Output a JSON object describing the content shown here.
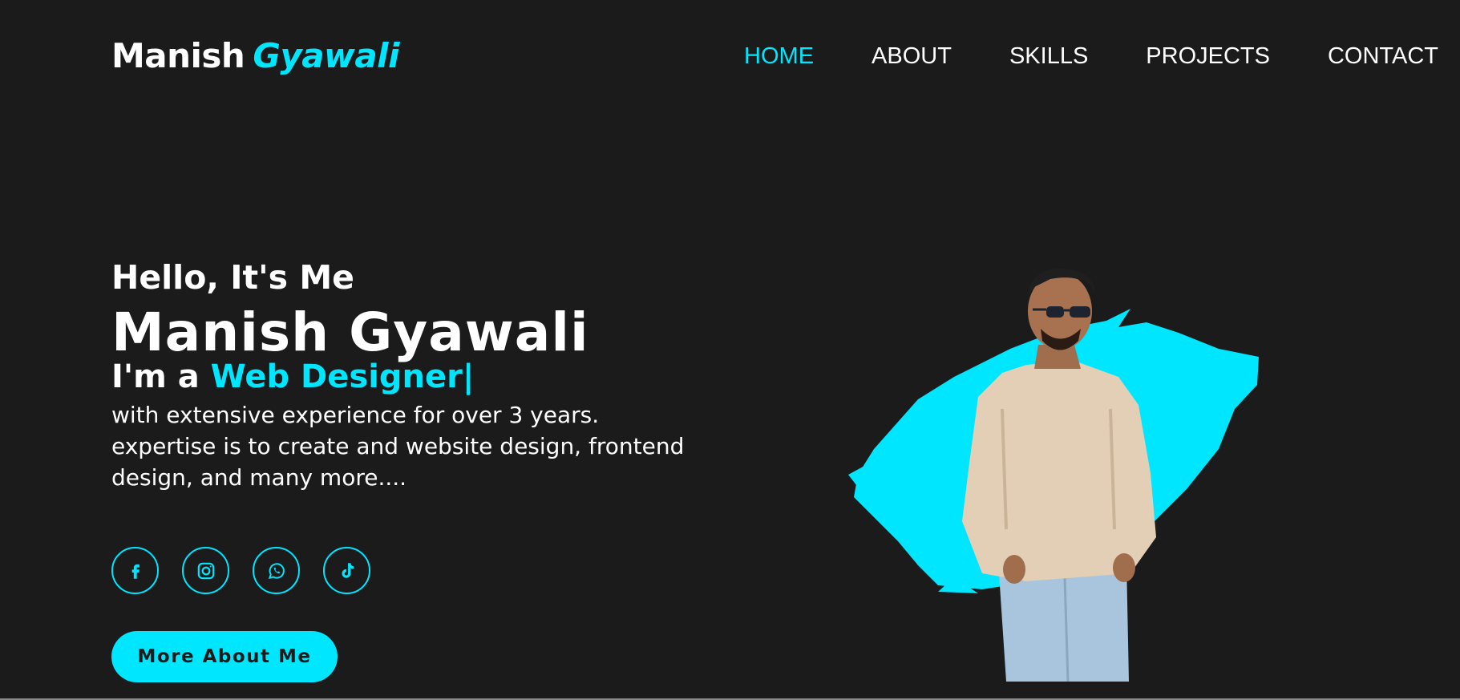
{
  "header": {
    "logo_first": "Manish",
    "logo_last": "Gyawali",
    "nav": [
      {
        "label": "HOME",
        "active": true
      },
      {
        "label": "ABOUT",
        "active": false
      },
      {
        "label": "SKILLS",
        "active": false
      },
      {
        "label": "PROJECTS",
        "active": false
      },
      {
        "label": "CONTACT",
        "active": false
      }
    ]
  },
  "hero": {
    "greeting": "Hello, It's Me",
    "name": "Manish Gyawali",
    "role_prefix": "I'm a",
    "role_highlight": "Web Designer|",
    "description_lines": [
      "with extensive experience for over 3 years.",
      "expertise is to create and website design, frontend",
      "design, and many more...."
    ],
    "socials": [
      "facebook-icon",
      "instagram-icon",
      "whatsapp-icon",
      "tiktok-icon"
    ],
    "cta_label": "More About Me"
  },
  "colors": {
    "accent": "#00e6ff",
    "background": "#1b1b1b",
    "text": "#ffffff"
  }
}
